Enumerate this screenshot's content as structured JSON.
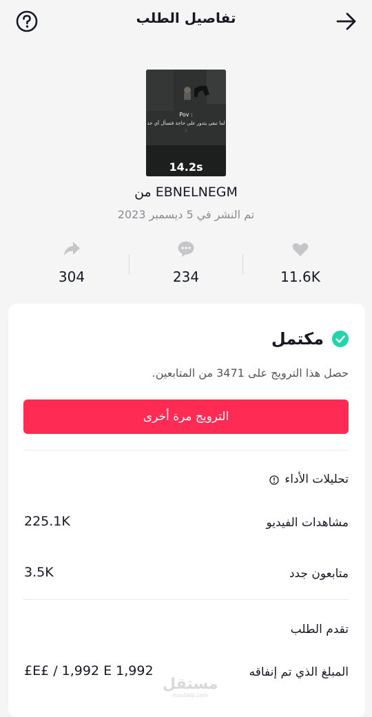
{
  "header": {
    "title": "تفاصيل الطلب"
  },
  "video": {
    "pov_text": "Pov :",
    "caption": "لما تبقى بتدور على حاجة فتسأل أي حد :",
    "duration": "14.2s",
    "author": "من EBNELNEGM",
    "published": "تم النشر في 5 ديسمبر 2023"
  },
  "stats": {
    "likes": "11.6K",
    "comments": "234",
    "shares": "304"
  },
  "order": {
    "status": "مكتمل",
    "description": "حصل هذا الترويج على 3471 من المتابعين.",
    "promote_again": "الترويج مرة أخرى"
  },
  "analytics": {
    "title": "تحليلات الأداء",
    "video_views_label": "مشاهدات الفيديو",
    "video_views_value": "225.1K",
    "new_followers_label": "متابعون جدد",
    "new_followers_value": "3.5K"
  },
  "progress": {
    "title": "تقدم الطلب",
    "spent_label": "المبلغ الذي تم إنفاقه",
    "spent_value": "£E£ / 1,992 E 1,992"
  },
  "watermark": {
    "text": "مستقل",
    "sub": "mostaql.com"
  },
  "colors": {
    "accent": "#fe2c55",
    "success": "#20d5ac",
    "icon_gray": "#c6c6ca"
  }
}
